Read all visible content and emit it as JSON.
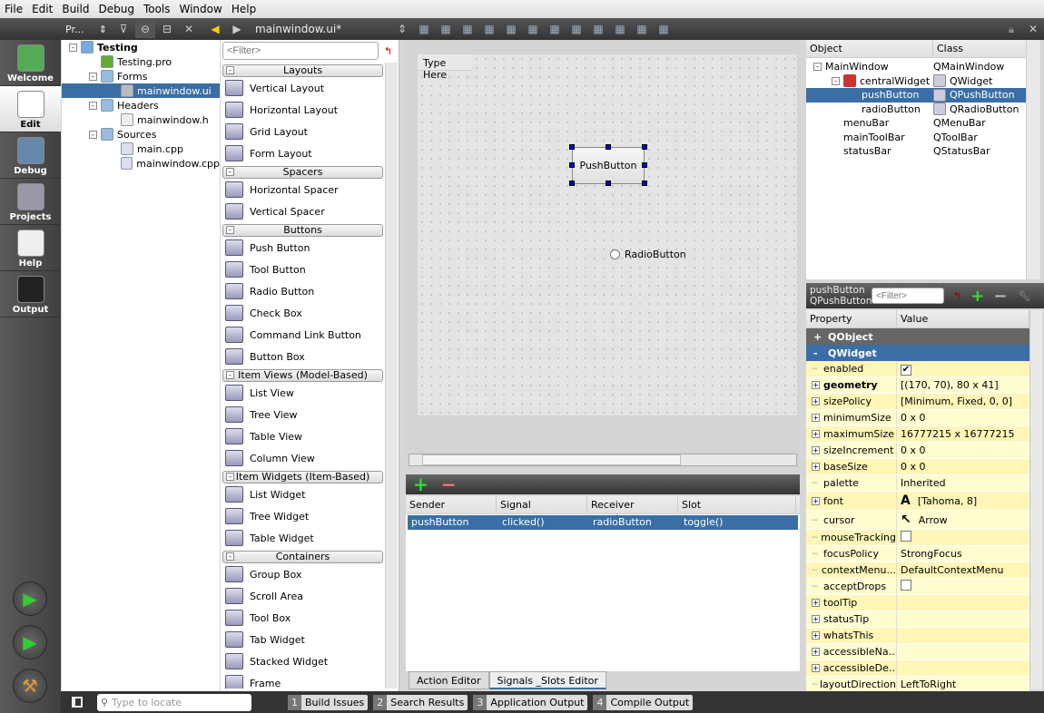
{
  "menu": [
    "File",
    "Edit",
    "Build",
    "Debug",
    "Tools",
    "Window",
    "Help"
  ],
  "toolbar": {
    "projects_selector": "Pr...",
    "current_file": "mainwindow.ui*"
  },
  "modes": [
    "Welcome",
    "Edit",
    "Debug",
    "Projects",
    "Help",
    "Output"
  ],
  "project_tree": [
    {
      "label": "Testing",
      "level": 0,
      "bold": true,
      "expand": "-",
      "icon": "project-folder-icon"
    },
    {
      "label": "Testing.pro",
      "level": 1,
      "icon": "pro-file-icon"
    },
    {
      "label": "Forms",
      "level": 1,
      "expand": "-",
      "icon": "forms-folder-icon"
    },
    {
      "label": "mainwindow.ui",
      "level": 2,
      "selected": true,
      "icon": "ui-file-icon"
    },
    {
      "label": "Headers",
      "level": 1,
      "expand": "-",
      "icon": "headers-folder-icon"
    },
    {
      "label": "mainwindow.h",
      "level": 2,
      "icon": "header-file-icon"
    },
    {
      "label": "Sources",
      "level": 1,
      "expand": "-",
      "icon": "sources-folder-icon"
    },
    {
      "label": "main.cpp",
      "level": 2,
      "icon": "cpp-file-icon"
    },
    {
      "label": "mainwindow.cpp",
      "level": 2,
      "icon": "cpp-file-icon"
    }
  ],
  "widget_box": {
    "filter_placeholder": "<Filter>",
    "categories": [
      {
        "name": "Layouts",
        "items": [
          "Vertical Layout",
          "Horizontal Layout",
          "Grid Layout",
          "Form Layout"
        ]
      },
      {
        "name": "Spacers",
        "items": [
          "Horizontal Spacer",
          "Vertical Spacer"
        ]
      },
      {
        "name": "Buttons",
        "items": [
          "Push Button",
          "Tool Button",
          "Radio Button",
          "Check Box",
          "Command Link Button",
          "Button Box"
        ]
      },
      {
        "name": "Item Views (Model-Based)",
        "items": [
          "List View",
          "Tree View",
          "Table View",
          "Column View"
        ]
      },
      {
        "name": "Item Widgets (Item-Based)",
        "items": [
          "List Widget",
          "Tree Widget",
          "Table Widget"
        ]
      },
      {
        "name": "Containers",
        "items": [
          "Group Box",
          "Scroll Area",
          "Tool Box",
          "Tab Widget",
          "Stacked Widget",
          "Frame"
        ]
      }
    ]
  },
  "form": {
    "menu_placeholder": "Type Here",
    "push_button": "PushButton",
    "radio_button": "RadioButton"
  },
  "signals": {
    "headers": [
      "Sender",
      "Signal",
      "Receiver",
      "Slot"
    ],
    "rows": [
      [
        "pushButton",
        "clicked()",
        "radioButton",
        "toggle()"
      ]
    ],
    "tabs": [
      "Action Editor",
      "Signals _Slots Editor"
    ],
    "active_tab": 1
  },
  "object_inspector": {
    "headers": [
      "Object",
      "Class"
    ],
    "rows": [
      {
        "object": "MainWindow",
        "class": "QMainWindow",
        "level": 0
      },
      {
        "object": "centralWidget",
        "class": "QWidget",
        "level": 1
      },
      {
        "object": "pushButton",
        "class": "QPushButton",
        "level": 2,
        "selected": true
      },
      {
        "object": "radioButton",
        "class": "QRadioButton",
        "level": 2
      },
      {
        "object": "menuBar",
        "class": "QMenuBar",
        "level": 1
      },
      {
        "object": "mainToolBar",
        "class": "QToolBar",
        "level": 1
      },
      {
        "object": "statusBar",
        "class": "QStatusBar",
        "level": 1
      }
    ]
  },
  "property_editor": {
    "object_name": "pushButton",
    "object_class": "QPushButton",
    "filter_placeholder": "<Filter>",
    "headers": [
      "Property",
      "Value"
    ],
    "groups": [
      {
        "name": "QObject",
        "expand": "+"
      },
      {
        "name": "QWidget",
        "expand": "-"
      }
    ],
    "rows": [
      {
        "name": "enabled",
        "value": "",
        "checkbox": true,
        "checked": true
      },
      {
        "name": "geometry",
        "value": "[(170, 70), 80 x 41]",
        "bold": true,
        "expandable": true
      },
      {
        "name": "sizePolicy",
        "value": "[Minimum, Fixed, 0, 0]",
        "expandable": true
      },
      {
        "name": "minimumSize",
        "value": "0 x 0",
        "expandable": true
      },
      {
        "name": "maximumSize",
        "value": "16777215 x 16777215",
        "expandable": true
      },
      {
        "name": "sizeIncrement",
        "value": "0 x 0",
        "expandable": true
      },
      {
        "name": "baseSize",
        "value": "0 x 0",
        "expandable": true
      },
      {
        "name": "palette",
        "value": "Inherited"
      },
      {
        "name": "font",
        "value": "[Tahoma, 8]",
        "expandable": true,
        "icon": "A"
      },
      {
        "name": "cursor",
        "value": "Arrow",
        "icon": "↖"
      },
      {
        "name": "mouseTracking",
        "value": "",
        "checkbox": true,
        "checked": false
      },
      {
        "name": "focusPolicy",
        "value": "StrongFocus"
      },
      {
        "name": "contextMenu...",
        "value": "DefaultContextMenu"
      },
      {
        "name": "acceptDrops",
        "value": "",
        "checkbox": true,
        "checked": false
      },
      {
        "name": "toolTip",
        "value": "",
        "expandable": true
      },
      {
        "name": "statusTip",
        "value": "",
        "expandable": true
      },
      {
        "name": "whatsThis",
        "value": "",
        "expandable": true
      },
      {
        "name": "accessibleNa...",
        "value": "",
        "expandable": true
      },
      {
        "name": "accessibleDe...",
        "value": "",
        "expandable": true
      },
      {
        "name": "layoutDirection",
        "value": "LeftToRight"
      }
    ]
  },
  "statusbar": {
    "locate_placeholder": "Type to locate",
    "panes": [
      {
        "n": "1",
        "label": "Build Issues"
      },
      {
        "n": "2",
        "label": "Search Results"
      },
      {
        "n": "3",
        "label": "Application Output"
      },
      {
        "n": "4",
        "label": "Compile Output"
      }
    ]
  },
  "colors": {
    "selection": "#3a6ea5",
    "property_row": "#fff6b8",
    "dark_panel": "#3a3a3a"
  }
}
